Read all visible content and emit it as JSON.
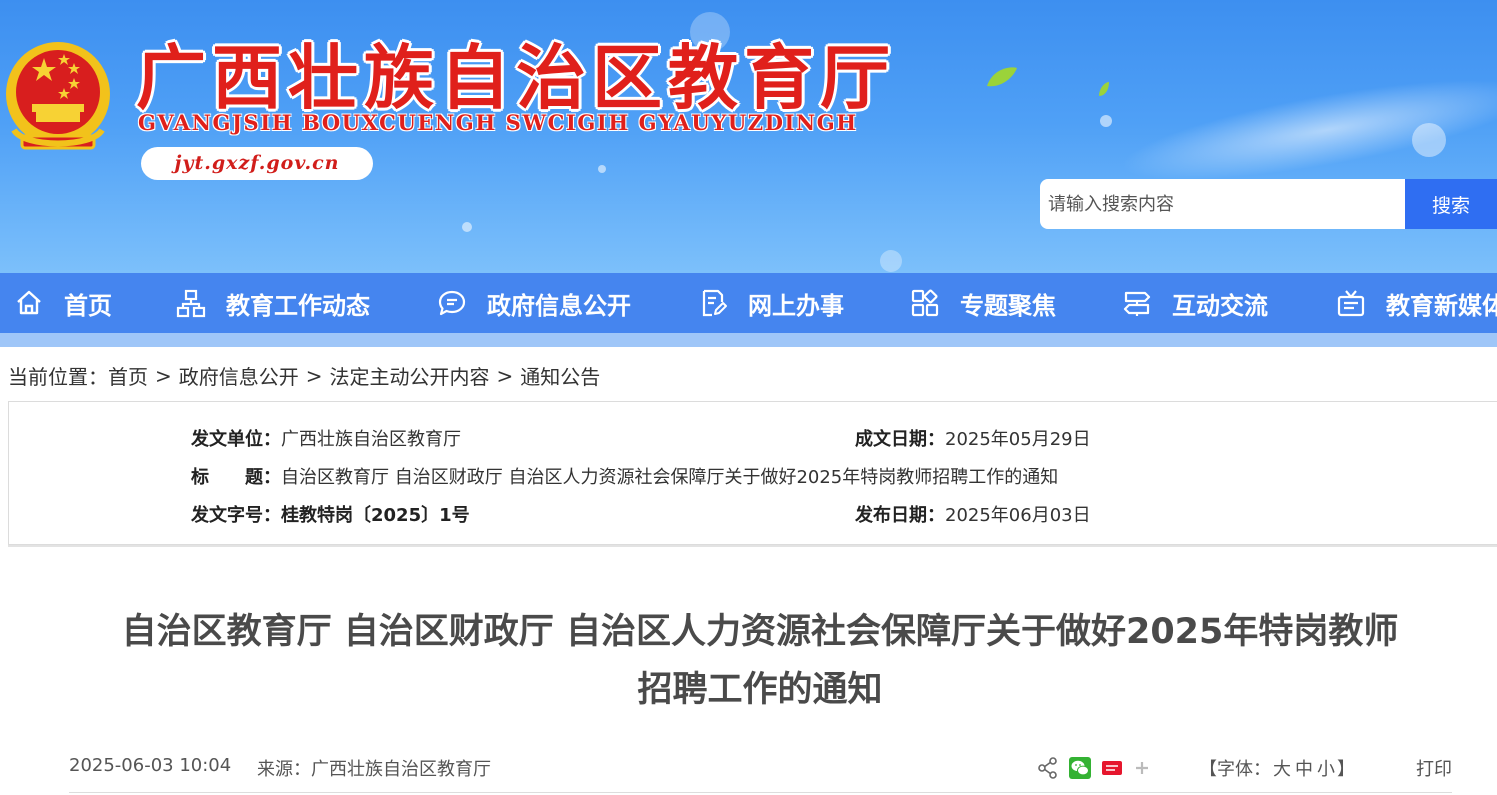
{
  "header": {
    "site_title": "广西壮族自治区教育厅",
    "site_subtitle": "GVANGJSIH BOUXCUENGH SWCIGIH GYAUYUZDINGH",
    "domain": "jyt.gxzf.gov.cn",
    "search_placeholder": "请输入搜索内容",
    "search_button": "搜索"
  },
  "nav": {
    "items": [
      {
        "label": "首页",
        "icon": "home-icon"
      },
      {
        "label": "教育工作动态",
        "icon": "org-chart-icon"
      },
      {
        "label": "政府信息公开",
        "icon": "chat-bubble-icon"
      },
      {
        "label": "网上办事",
        "icon": "edit-document-icon"
      },
      {
        "label": "专题聚焦",
        "icon": "grid-icon"
      },
      {
        "label": "互动交流",
        "icon": "signpost-icon"
      },
      {
        "label": "教育新媒体",
        "icon": "media-icon"
      }
    ]
  },
  "breadcrumb": {
    "prefix": "当前位置：",
    "items": [
      "首页",
      "政府信息公开",
      "法定主动公开内容",
      "通知公告"
    ],
    "separator": ">"
  },
  "meta": {
    "issuer_label": "发文单位：",
    "issuer": "广西壮族自治区教育厅",
    "date_written_label": "成文日期：",
    "date_written": "2025年05月29日",
    "title_label": "标　　题：",
    "title": "自治区教育厅 自治区财政厅 自治区人力资源社会保障厅关于做好2025年特岗教师招聘工作的通知",
    "doc_no_label": "发文字号：",
    "doc_no": "桂教特岗〔2025〕1号",
    "publish_date_label": "发布日期：",
    "publish_date": "2025年06月03日"
  },
  "article": {
    "title_line1": "自治区教育厅 自治区财政厅 自治区人力资源社会保障厅关于做好2025年特岗教师",
    "title_line2": "招聘工作的通知",
    "pub_time": "2025-06-03 10:04",
    "source": "来源：广西壮族自治区教育厅",
    "font_prefix": "【字体：",
    "font_large": "大",
    "font_medium": "中",
    "font_small": "小",
    "font_suffix": "】",
    "print": "打印",
    "share_icons": [
      "share-icon",
      "wechat-icon",
      "weibo-icon",
      "plus-icon"
    ]
  },
  "colors": {
    "nav_bg": "#4585ef",
    "title_red": "#e0201b",
    "search_button": "#2f6ef2"
  }
}
